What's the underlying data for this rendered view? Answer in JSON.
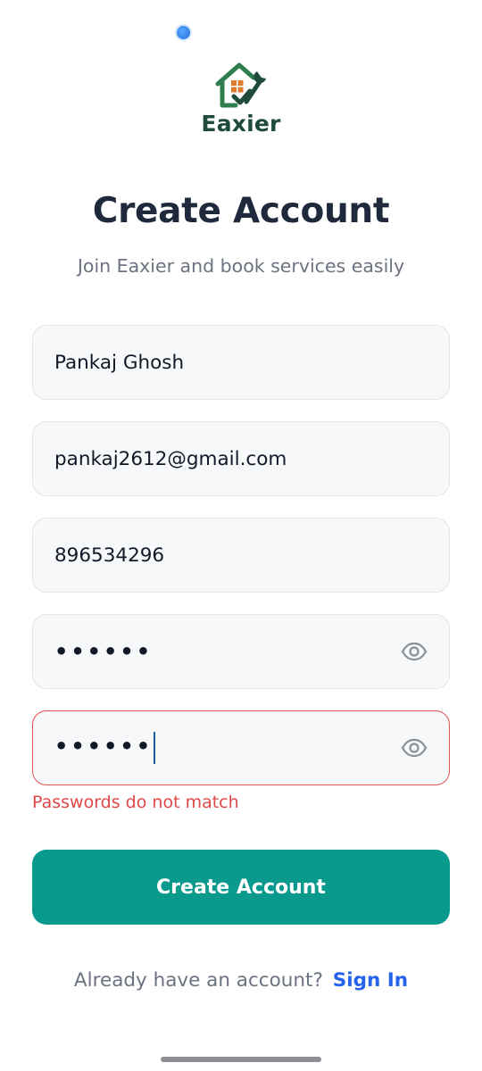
{
  "app": {
    "brand": "Eaxier",
    "logo_icon": "house-wrench-icon"
  },
  "header": {
    "title": "Create Account",
    "subtitle": "Join Eaxier and book services easily"
  },
  "form": {
    "name_value": "Pankaj Ghosh",
    "email_value": "pankaj2612@gmail.com",
    "phone_value": "896534296",
    "password_value": "••••••",
    "confirm_password_value": "••••••",
    "password_icon": "eye-icon",
    "error_message": "Passwords do not match",
    "submit_label": "Create Account"
  },
  "footer": {
    "prompt": "Already have an account?",
    "signin_label": "Sign In"
  },
  "colors": {
    "primary": "#0a9a8d",
    "link": "#2563eb",
    "error": "#e04848",
    "title": "#1e293b",
    "brand": "#1f4b3c"
  }
}
